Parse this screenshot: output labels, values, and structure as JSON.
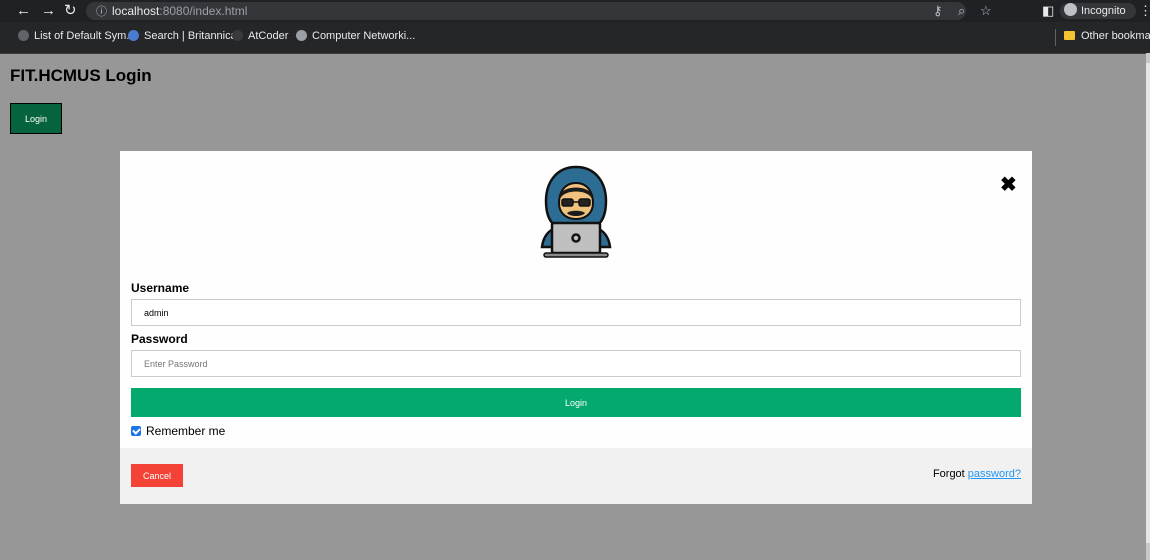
{
  "browser": {
    "url_host": "localhost",
    "url_path": ":8080/index.html",
    "incognito_label": "Incognito",
    "bookmarks": [
      {
        "label": "List of Default Sym...",
        "color": "#606368"
      },
      {
        "label": "Search | Britannica",
        "color": "#4a7bd0"
      },
      {
        "label": "AtCoder",
        "color": "#3a3a3a"
      },
      {
        "label": "Computer Networki...",
        "color": "#9aa0a6"
      }
    ],
    "other_bookmarks": "Other bookmarks"
  },
  "page": {
    "title": "FIT.HCMUS Login",
    "open_button": "Login"
  },
  "modal": {
    "close_glyph": "✖",
    "username_label": "Username",
    "username_value": "admin",
    "password_label": "Password",
    "password_placeholder": "Enter Password",
    "submit_label": "Login",
    "remember_label": "Remember me",
    "remember_checked": true,
    "cancel_label": "Cancel",
    "forgot_prefix": "Forgot",
    "forgot_link": "password?"
  }
}
